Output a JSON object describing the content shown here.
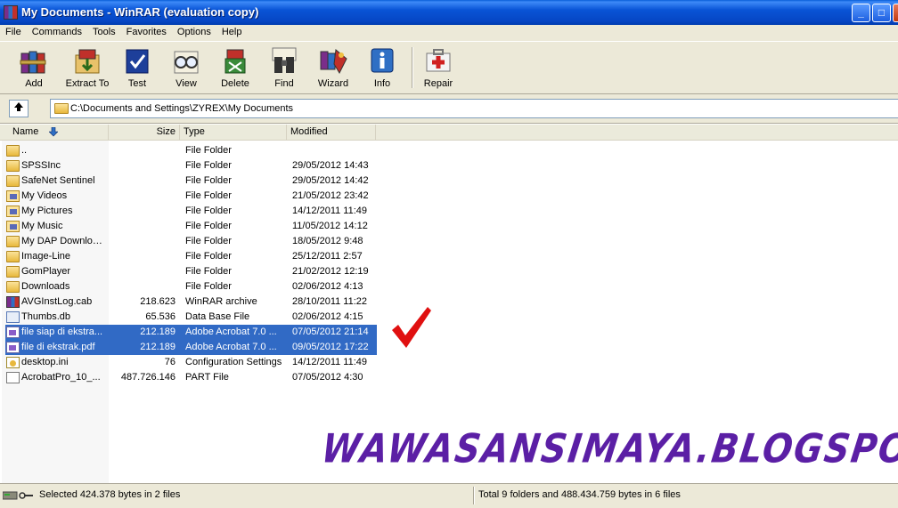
{
  "window": {
    "title": "My Documents - WinRAR (evaluation copy)",
    "minimize": "_",
    "maximize": "□",
    "close": "✕"
  },
  "menu": [
    "File",
    "Commands",
    "Tools",
    "Favorites",
    "Options",
    "Help"
  ],
  "toolbar": [
    {
      "label": "Add",
      "icon": "add-books-icon"
    },
    {
      "label": "Extract To",
      "icon": "extract-folder-icon"
    },
    {
      "label": "Test",
      "icon": "test-check-icon"
    },
    {
      "label": "View",
      "icon": "view-glasses-icon"
    },
    {
      "label": "Delete",
      "icon": "delete-icon"
    },
    {
      "label": "Find",
      "icon": "find-binoculars-icon"
    },
    {
      "label": "Wizard",
      "icon": "wizard-icon"
    },
    {
      "label": "Info",
      "icon": "info-icon"
    },
    {
      "label": "Repair",
      "icon": "repair-firstaid-icon"
    }
  ],
  "address": {
    "path": "C:\\Documents and Settings\\ZYREX\\My Documents"
  },
  "columns": {
    "name": "Name",
    "size": "Size",
    "type": "Type",
    "modified": "Modified"
  },
  "files": [
    {
      "name": "..",
      "size": "",
      "type": "File Folder",
      "modified": "",
      "icon": "folder-icon"
    },
    {
      "name": "SPSSInc",
      "size": "",
      "type": "File Folder",
      "modified": "29/05/2012 14:43",
      "icon": "folder-icon"
    },
    {
      "name": "SafeNet Sentinel",
      "size": "",
      "type": "File Folder",
      "modified": "29/05/2012 14:42",
      "icon": "folder-icon"
    },
    {
      "name": "My Videos",
      "size": "",
      "type": "File Folder",
      "modified": "21/05/2012 23:42",
      "icon": "videos-folder-icon"
    },
    {
      "name": "My Pictures",
      "size": "",
      "type": "File Folder",
      "modified": "14/12/2011 11:49",
      "icon": "pictures-folder-icon"
    },
    {
      "name": "My Music",
      "size": "",
      "type": "File Folder",
      "modified": "11/05/2012 14:12",
      "icon": "music-folder-icon"
    },
    {
      "name": "My DAP Downloads",
      "size": "",
      "type": "File Folder",
      "modified": "18/05/2012 9:48",
      "icon": "folder-icon"
    },
    {
      "name": "Image-Line",
      "size": "",
      "type": "File Folder",
      "modified": "25/12/2011 2:57",
      "icon": "folder-icon"
    },
    {
      "name": "GomPlayer",
      "size": "",
      "type": "File Folder",
      "modified": "21/02/2012 12:19",
      "icon": "folder-icon"
    },
    {
      "name": "Downloads",
      "size": "",
      "type": "File Folder",
      "modified": "02/06/2012 4:13",
      "icon": "folder-icon"
    },
    {
      "name": "AVGInstLog.cab",
      "size": "218.623",
      "type": "WinRAR archive",
      "modified": "28/10/2011 11:22",
      "icon": "archive-icon"
    },
    {
      "name": "Thumbs.db",
      "size": "65.536",
      "type": "Data Base File",
      "modified": "02/06/2012 4:15",
      "icon": "database-file-icon"
    },
    {
      "name": "file siap di ekstra...",
      "size": "212.189",
      "type": "Adobe Acrobat 7.0 ...",
      "modified": "07/05/2012 21:14",
      "icon": "pdf-file-icon",
      "selected": true
    },
    {
      "name": "file di ekstrak.pdf",
      "size": "212.189",
      "type": "Adobe Acrobat 7.0 ...",
      "modified": "09/05/2012 17:22",
      "icon": "pdf-file-icon",
      "selected": true
    },
    {
      "name": "desktop.ini",
      "size": "76",
      "type": "Configuration Settings",
      "modified": "14/12/2011 11:49",
      "icon": "ini-file-icon"
    },
    {
      "name": "AcrobatPro_10_...",
      "size": "487.726.146",
      "type": "PART File",
      "modified": "07/05/2012 4:30",
      "icon": "part-file-icon"
    }
  ],
  "watermark": "WAWASANSIMAYA.BLOGSPOT.COM",
  "status": {
    "selected": "Selected 424.378 bytes in 2 files",
    "total": "Total 9 folders and 488.434.759 bytes in 6 files"
  },
  "colors": {
    "selection": "#316ac5",
    "watermark": "#5b1fa5",
    "checkmark": "#e01010",
    "titlebar": "#0954d6"
  }
}
